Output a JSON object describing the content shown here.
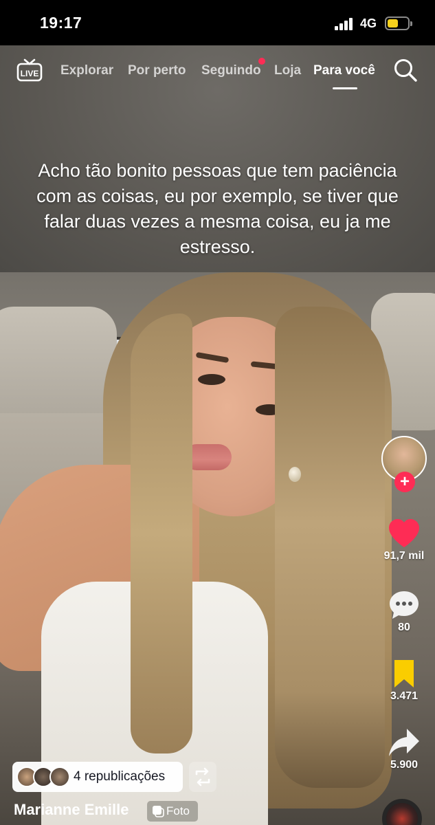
{
  "status_bar": {
    "time": "19:17",
    "network": "4G",
    "battery_level": 0.4,
    "battery_color": "#f6d11d"
  },
  "top_nav": {
    "live_label": "LIVE",
    "tabs": [
      {
        "label": "Explorar"
      },
      {
        "label": "Por perto"
      },
      {
        "label": "Seguindo"
      },
      {
        "label": "Loja"
      },
      {
        "label": "Para você",
        "active": true
      }
    ],
    "notification_dot_color": "#fe2c55",
    "search_icon": "search-icon"
  },
  "post": {
    "overlay_text": "Acho tão bonito pessoas que tem paciência com as coisas, eu por exemplo, se tiver que falar duas vezes a mesma coisa, eu ja me estresso.",
    "author": "Marianne Emille",
    "media_type_label": "Foto",
    "reposts_label": "4 republicações"
  },
  "actions": {
    "likes": "91,7 mil",
    "comments": "80",
    "saves": "3.471",
    "shares": "5.900",
    "like_color": "#fe2c55",
    "save_color": "#facd00"
  }
}
